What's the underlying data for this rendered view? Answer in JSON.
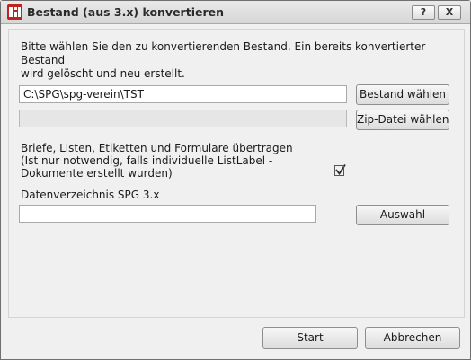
{
  "window": {
    "title": "Bestand (aus 3.x) konvertieren",
    "help_label": "?",
    "close_label": "X"
  },
  "intro_text": "Bitte wählen Sie den zu konvertierenden Bestand. Ein bereits konvertierter Bestand\nwird gelöscht und neu erstellt.",
  "bestand": {
    "path_value": "C:\\SPG\\spg-verein\\TST",
    "choose_label": "Bestand wählen"
  },
  "zip": {
    "path_value": "",
    "choose_label": "Zip-Datei wählen"
  },
  "transfer": {
    "label": "Briefe, Listen, Etiketten und Formulare übertragen\n(Ist nur notwendig, falls individuelle ListLabel -\nDokumente erstellt wurden)",
    "checked": true
  },
  "data_dir": {
    "label": "Datenverzeichnis SPG 3.x",
    "path_value": "",
    "choose_label": "Auswahl"
  },
  "footer": {
    "start_label": "Start",
    "cancel_label": "Abbrechen"
  }
}
